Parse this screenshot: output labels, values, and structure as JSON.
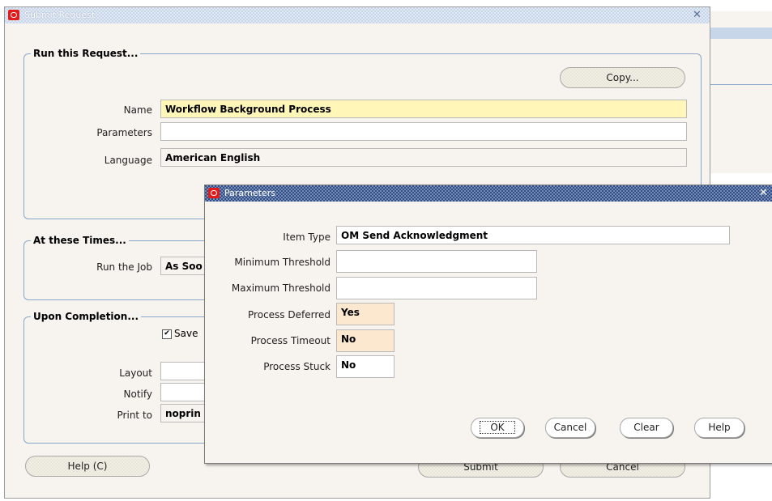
{
  "main_window": {
    "title": "Submit Request",
    "run_group": {
      "legend": "Run this Request...",
      "copy_button": "Copy...",
      "name_label": "Name",
      "name_value": "Workflow Background Process",
      "parameters_label": "Parameters",
      "parameters_value": "",
      "language_label": "Language",
      "language_value": "American English"
    },
    "times_group": {
      "legend": "At these Times...",
      "run_job_label": "Run the Job",
      "run_job_value": "As Soo"
    },
    "completion_group": {
      "legend": "Upon Completion...",
      "save_checkbox_label": "Save",
      "save_checked": true,
      "layout_label": "Layout",
      "notify_label": "Notify",
      "print_to_label": "Print to",
      "print_to_value": "noprin"
    },
    "help_button": "Help (C)",
    "submit_button": "Submit",
    "cancel_button": "Cancel"
  },
  "parameters_dialog": {
    "title": "Parameters",
    "fields": {
      "item_type_label": "Item Type",
      "item_type_value": "OM Send Acknowledgment",
      "min_threshold_label": "Minimum Threshold",
      "min_threshold_value": "",
      "max_threshold_label": "Maximum Threshold",
      "max_threshold_value": "",
      "process_deferred_label": "Process Deferred",
      "process_deferred_value": "Yes",
      "process_timeout_label": "Process Timeout",
      "process_timeout_value": "No",
      "process_stuck_label": "Process Stuck",
      "process_stuck_value": "No"
    },
    "buttons": {
      "ok": "OK",
      "cancel": "Cancel",
      "clear": "Clear",
      "help": "Help"
    }
  },
  "colors": {
    "required_field": "#fff6b8",
    "title_active": "#2f4f8a",
    "title_inactive": "#c8d6ea"
  }
}
